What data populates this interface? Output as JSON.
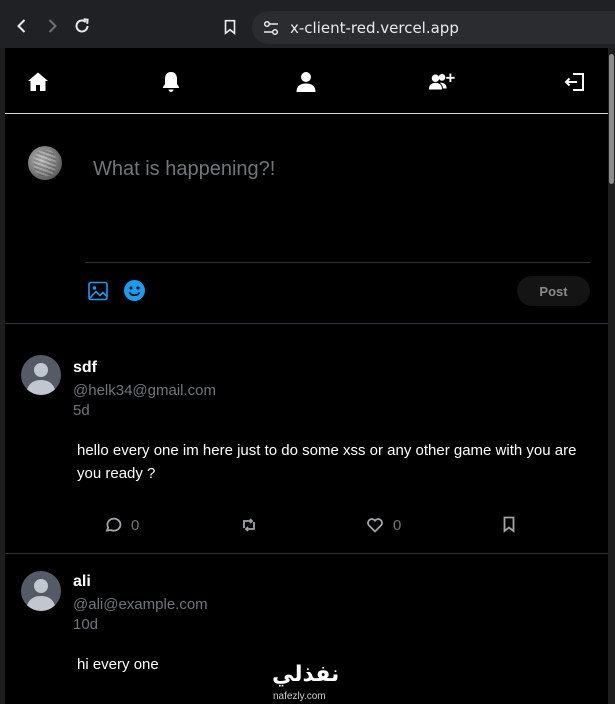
{
  "browser": {
    "url": "x-client-red.vercel.app"
  },
  "nav": {
    "icons": [
      "home-icon",
      "bell-icon",
      "user-icon",
      "user-plus-icon",
      "logout-icon"
    ]
  },
  "composer": {
    "placeholder": "What is happening?!",
    "post_label": "Post"
  },
  "posts": [
    {
      "name": "sdf",
      "handle": "@helk34@gmail.com",
      "time": "5d",
      "text": "hello every one im here just to do some xss or any other game with you are you ready ?",
      "comments": "0",
      "likes": "0"
    },
    {
      "name": "ali",
      "handle": "@ali@example.com",
      "time": "10d",
      "text": "hi every one"
    }
  ],
  "watermark": {
    "main": "نفذلي",
    "sub": "nafezly.com"
  },
  "colors": {
    "accent": "#1d9bf0",
    "background": "#000000",
    "muted": "#71767b"
  }
}
